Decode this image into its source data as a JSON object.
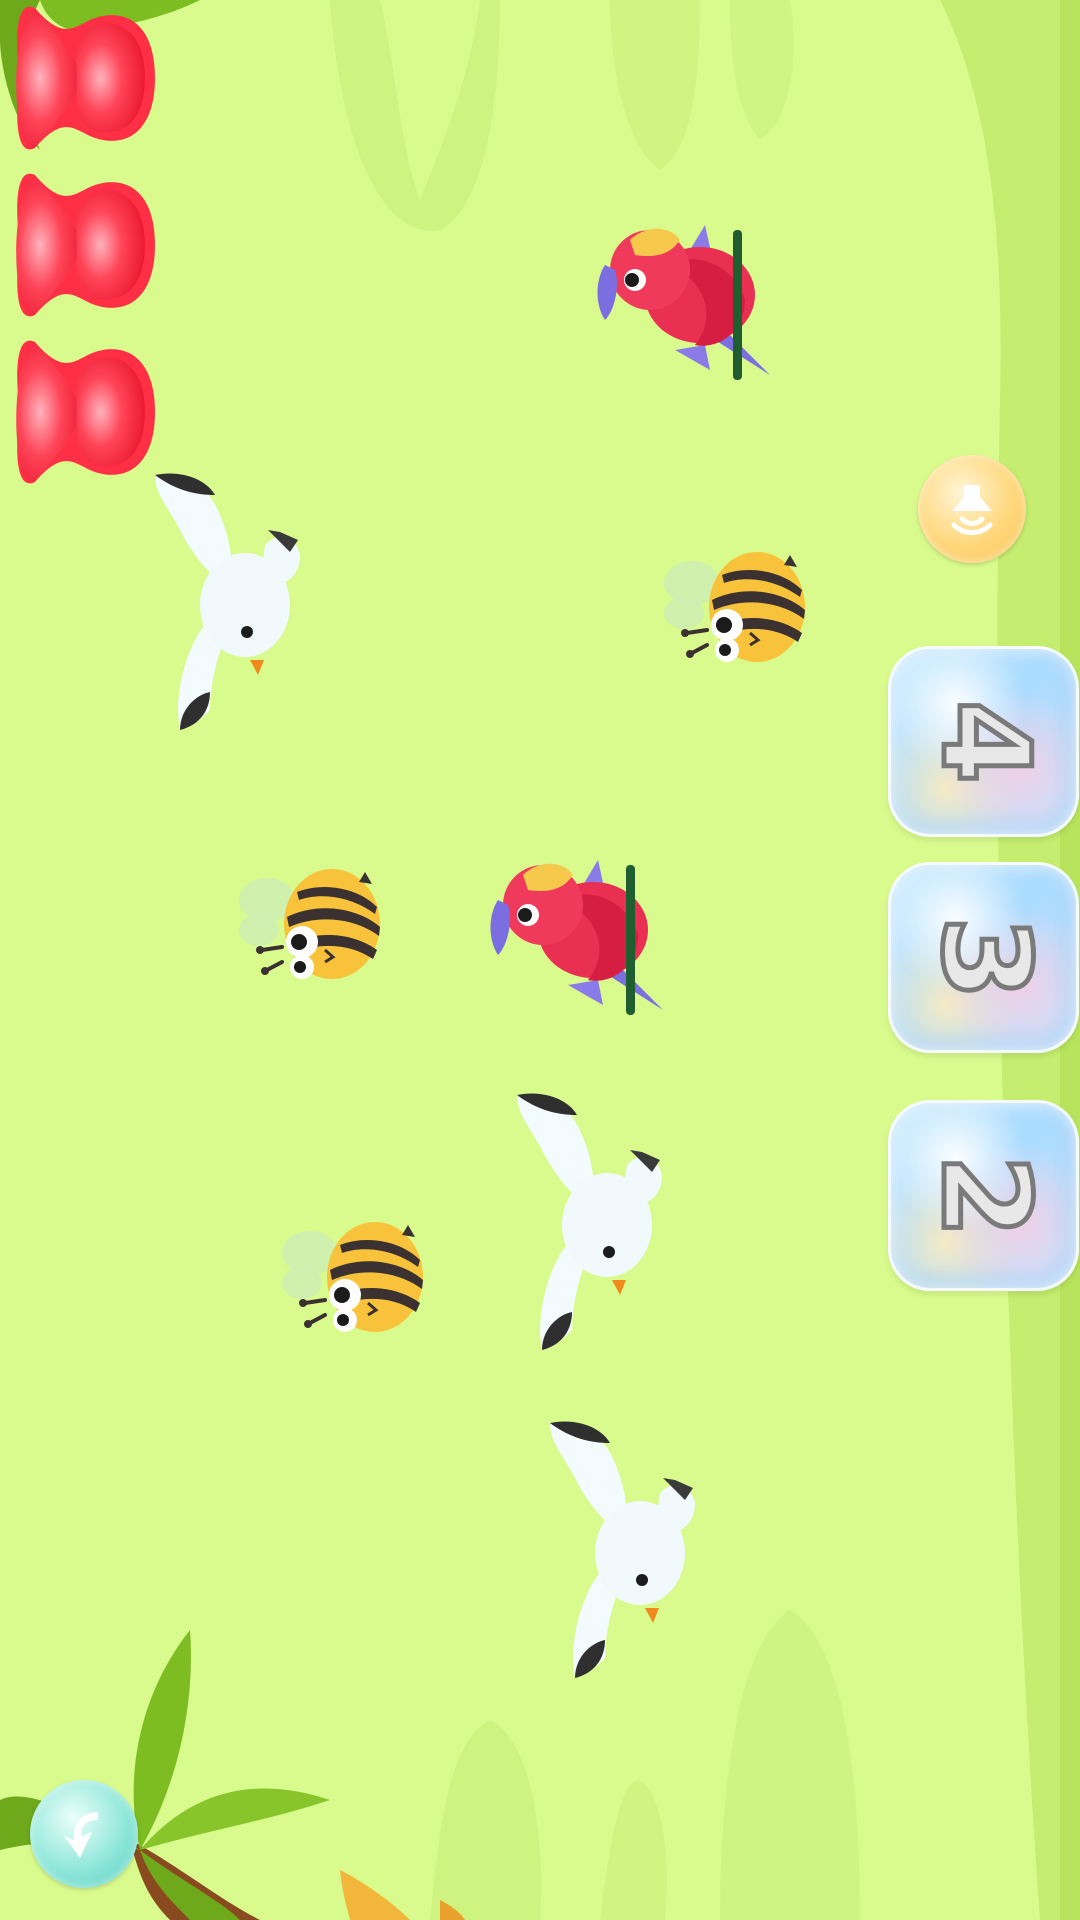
{
  "game": {
    "lives": 3,
    "answer_options": [
      "4",
      "3",
      "2"
    ]
  },
  "icons": {
    "heart": "heart-icon",
    "sound": "speaker-icon",
    "back": "back-arrow-icon"
  },
  "colors": {
    "background": "#d9fb8d",
    "heart": "#f4283f",
    "bubble": "#b6e0ff"
  }
}
